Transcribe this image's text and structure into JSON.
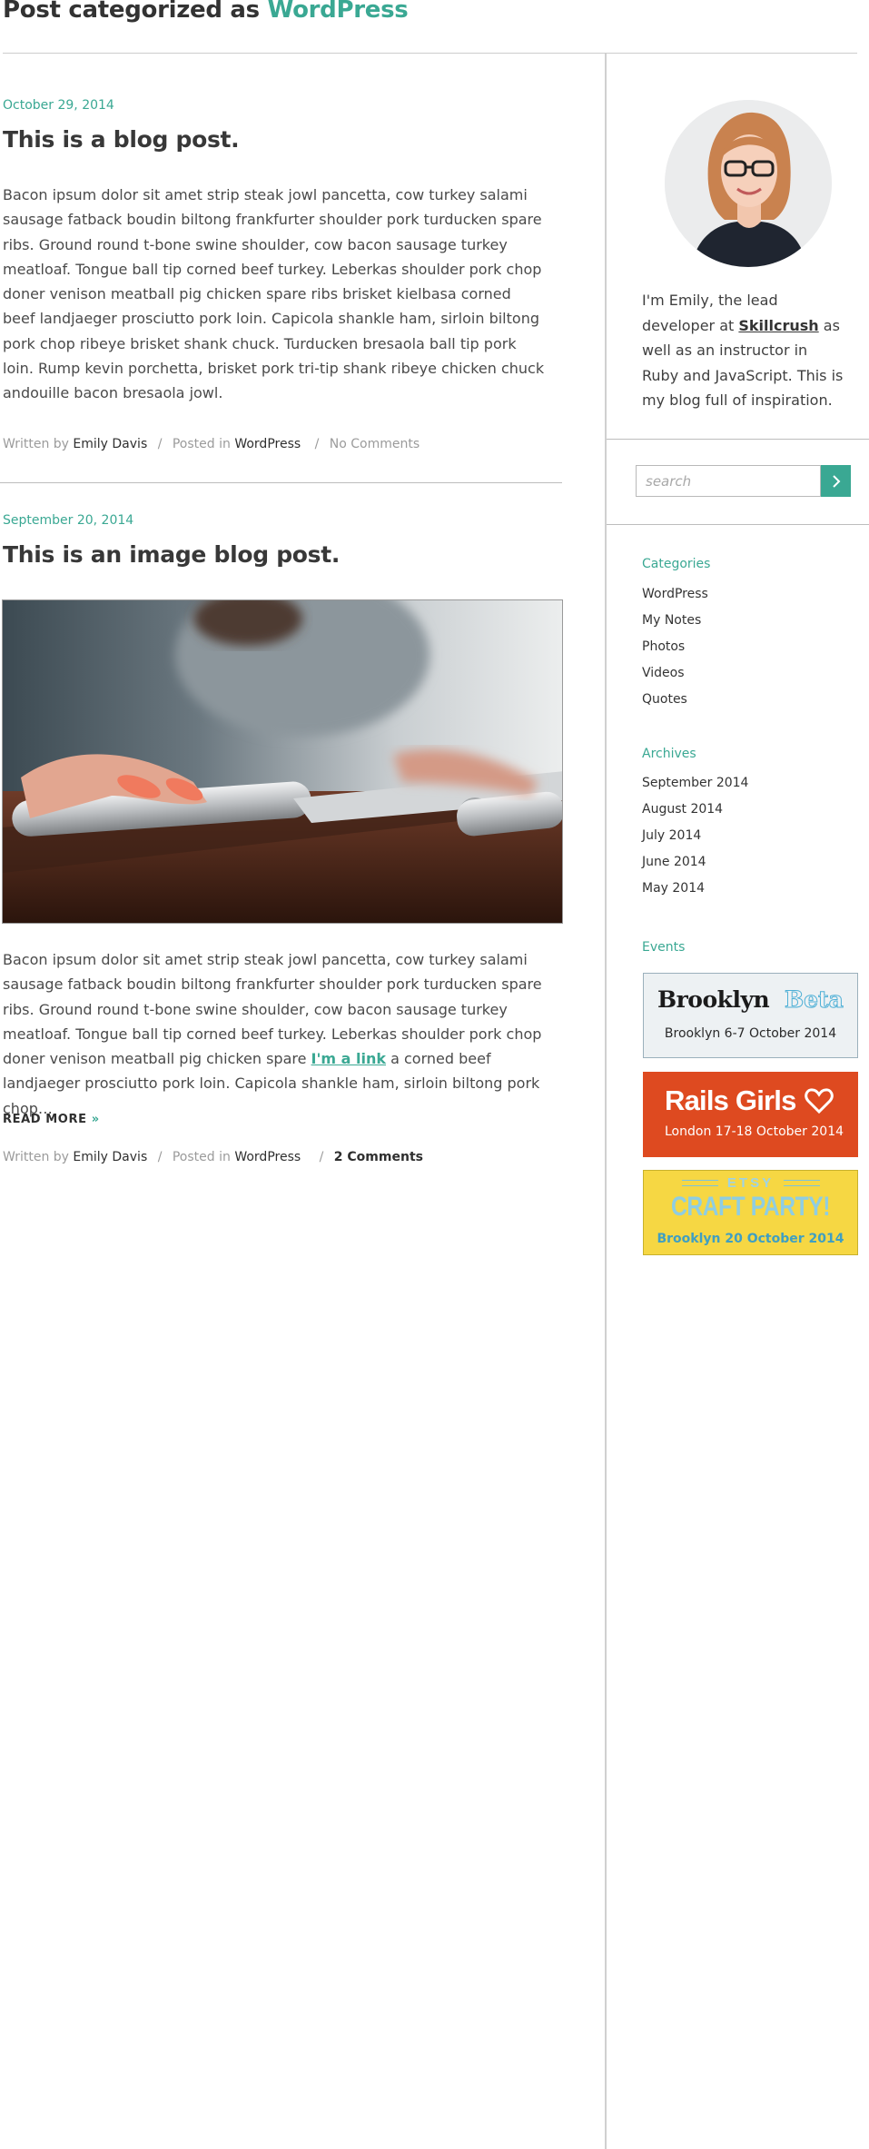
{
  "heading": {
    "prefix": "Post categorized as",
    "category": "WordPress"
  },
  "posts": [
    {
      "date": "October 29, 2014",
      "title": "This is a blog post.",
      "body": "Bacon ipsum dolor sit amet strip steak jowl pancetta, cow turkey salami sausage fatback boudin biltong frankfurter shoulder pork turducken spare ribs. Ground round t-bone swine shoulder, cow bacon sausage turkey meatloaf. Tongue ball tip corned beef turkey. Leberkas shoulder pork chop doner venison meatball pig chicken spare ribs brisket kielbasa corned beef landjaeger prosciutto pork loin. Capicola shankle ham, sirloin biltong pork chop ribeye brisket shank chuck. Turducken bresaola ball tip pork loin. Rump kevin porchetta, brisket pork tri-tip shank ribeye chicken chuck andouille bacon bresaola jowl.",
      "meta": {
        "written_by_label": "Written by",
        "author": "Emily Davis",
        "posted_in_label": "Posted in",
        "category": "WordPress",
        "comments": "No Comments"
      }
    },
    {
      "date": "September 20, 2014",
      "title": "This is an image blog post.",
      "body_before_link": "Bacon ipsum dolor sit amet strip steak jowl pancetta, cow turkey salami sausage fatback boudin biltong frankfurter shoulder pork turducken spare ribs. Ground round t-bone swine shoulder, cow bacon sausage turkey meatloaf. Tongue ball tip corned beef turkey. Leberkas shoulder pork chop doner venison meatball pig chicken spare",
      "link_text": "I'm a link",
      "body_after_link": "a corned beef landjaeger prosciutto pork loin. Capicola shankle ham, sirloin biltong pork chop…",
      "read_more": "READ MORE",
      "read_more_arrow": "»",
      "meta": {
        "written_by_label": "Written by",
        "author": "Emily Davis",
        "posted_in_label": "Posted in",
        "category": "WordPress",
        "comments": "2 Comments"
      }
    }
  ],
  "sidebar": {
    "bio_before": "I'm Emily, the lead developer at",
    "bio_link": "Skillcrush",
    "bio_after": "as well as an instructor in Ruby and JavaScript. This is my blog full of inspiration.",
    "search": {
      "placeholder": "search",
      "button_icon": "chevron-right-icon"
    },
    "categories": {
      "title": "Categories",
      "items": [
        "WordPress",
        "My Notes",
        "Photos",
        "Videos",
        "Quotes"
      ]
    },
    "archives": {
      "title": "Archives",
      "items": [
        "September 2014",
        "August 2014",
        "July 2014",
        "June 2014",
        "May 2014"
      ]
    },
    "events": {
      "title": "Events",
      "items": [
        {
          "name_part1": "Brooklyn",
          "name_part2": "Beta",
          "subtitle": "Brooklyn 6-7 October 2014"
        },
        {
          "name": "Rails Girls",
          "subtitle": "London 17-18 October 2014"
        },
        {
          "name_top": "ETSY",
          "name": "CRAFT PARTY!",
          "subtitle": "Brooklyn 20 October 2014"
        }
      ]
    }
  },
  "colors": {
    "accent": "#3aa893",
    "text": "#444444",
    "rule": "#cccccc",
    "rails_girls": "#de4a20",
    "etsy_yellow": "#f6d743"
  }
}
